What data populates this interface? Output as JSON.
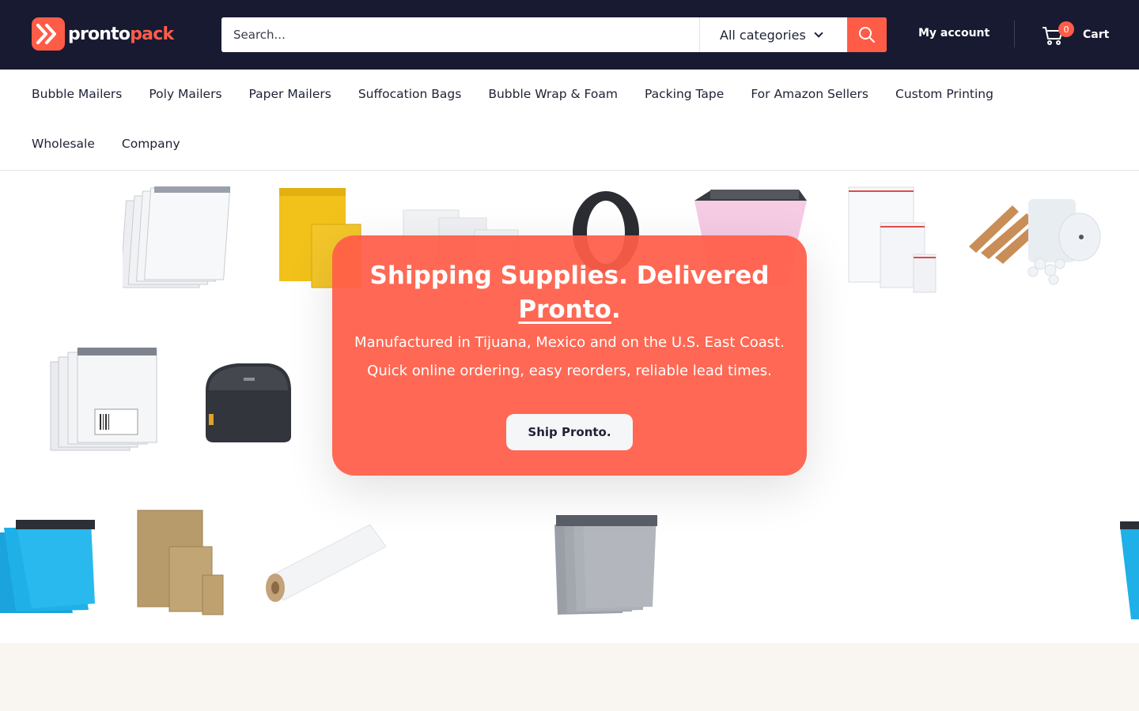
{
  "brand": {
    "logo_part1": "pronto",
    "logo_part2": "pack",
    "accent": "#ff5c47",
    "header_bg": "#171a31"
  },
  "search": {
    "placeholder": "Search...",
    "category_selected": "All categories",
    "button_icon": "search-icon"
  },
  "header": {
    "account_label": "My account",
    "cart_label": "Cart",
    "cart_count": "0"
  },
  "nav": {
    "items": [
      "Bubble Mailers",
      "Poly Mailers",
      "Paper Mailers",
      "Suffocation Bags",
      "Bubble Wrap & Foam",
      "Packing Tape",
      "For Amazon Sellers",
      "Custom Printing",
      "Wholesale",
      "Company"
    ]
  },
  "hero": {
    "title_line1": "Shipping Supplies. Delivered",
    "title_underlined": "Pronto",
    "title_end": ".",
    "subtitle": "Manufactured in Tijuana, Mexico and on the U.S. East Coast. Quick online ordering, easy reorders, reliable lead times.",
    "cta_label": "Ship Pronto."
  }
}
